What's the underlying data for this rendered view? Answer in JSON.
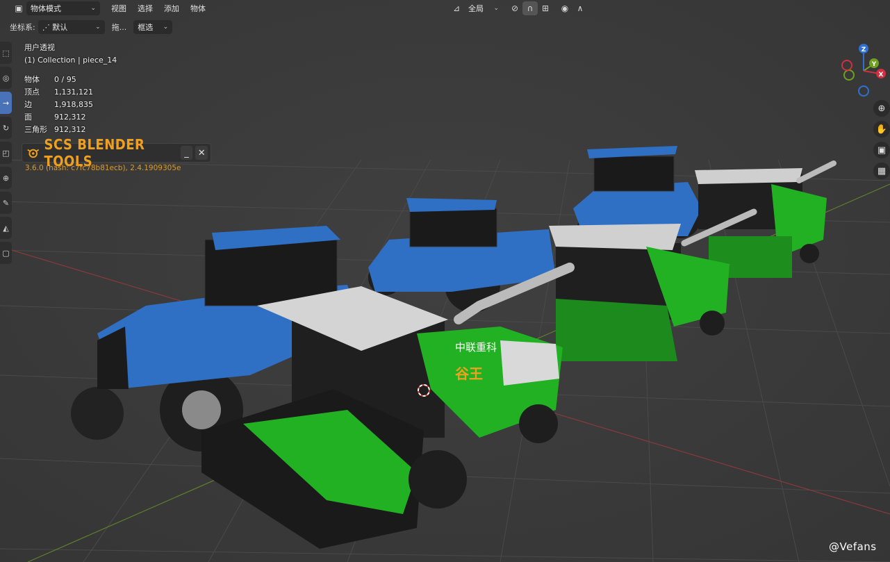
{
  "header": {
    "mode": "物体模式",
    "menus": [
      "视图",
      "选择",
      "添加",
      "物体"
    ],
    "transform_orientation": "全局"
  },
  "subheader": {
    "coord_label": "坐标系:",
    "coord_value": "默认",
    "drag_label": "拖...",
    "select_value": "框选"
  },
  "viewport_info": {
    "view_name": "用户透视",
    "collection": "(1) Collection | piece_14",
    "stats": [
      {
        "label": "物体",
        "value": "0 / 95"
      },
      {
        "label": "顶点",
        "value": "1,131,121"
      },
      {
        "label": "边",
        "value": "1,918,835"
      },
      {
        "label": "面",
        "value": "912,312"
      },
      {
        "label": "三角形",
        "value": "912,312"
      }
    ]
  },
  "scs_panel": {
    "title": "SCS BLENDER TOOLS",
    "minimize": "_",
    "close": "✕",
    "version": "3.6.0 (hash: c7fc78b81ecb), 2.4.1909305e"
  },
  "gizmo": {
    "z": "Z",
    "y": "Y",
    "x": "X"
  },
  "vehicle_text": {
    "brand": "中联重科",
    "model": "谷王"
  },
  "watermark": "@Vefans",
  "colors": {
    "tractor_blue": "#2f6fc4",
    "harvester_green": "#22b122",
    "scs_orange": "#f0a020",
    "active_tool": "#4a72b8"
  }
}
